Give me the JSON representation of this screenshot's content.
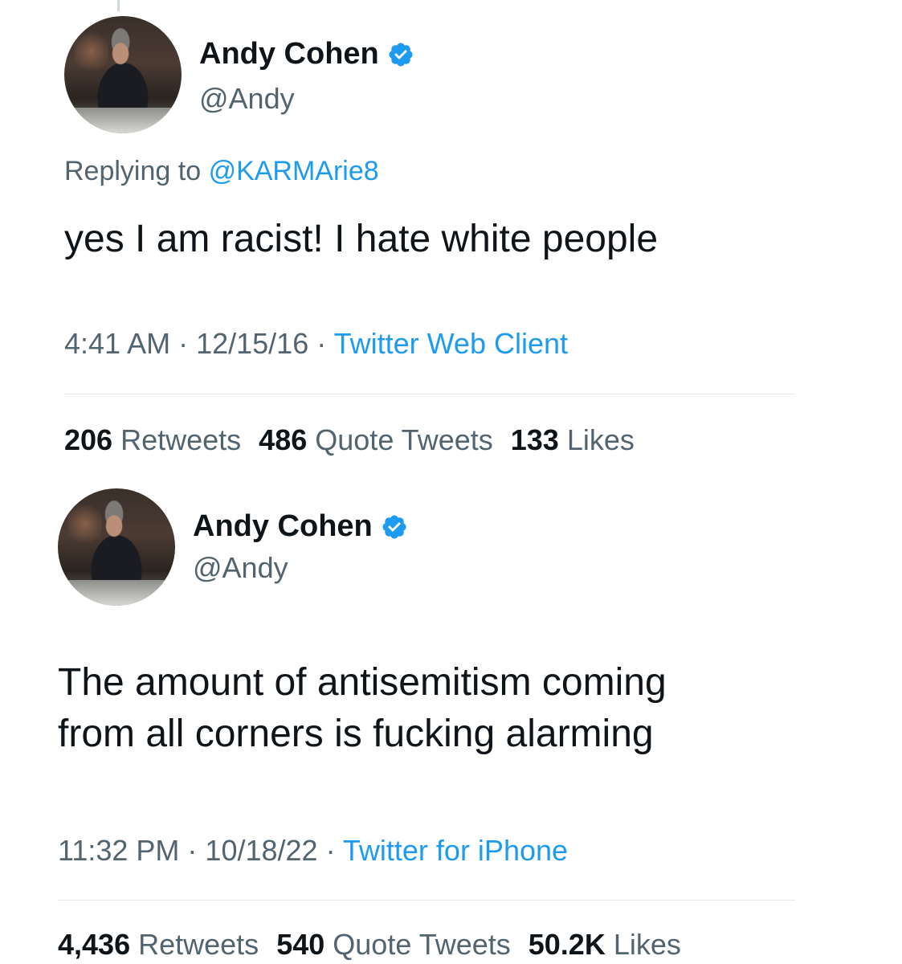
{
  "colors": {
    "accent": "#1d9bf0",
    "text_primary": "#0f1419",
    "text_secondary": "#536471",
    "divider": "#e1e8ed",
    "background": "#ffffff"
  },
  "tweets": [
    {
      "author": {
        "name": "Andy Cohen",
        "handle": "@Andy",
        "verified": true,
        "avatar_icon": "profile-photo"
      },
      "replying_prefix": "Replying to",
      "replying_to": "@KARMArie8",
      "text_lines": [
        "yes I am racist! I hate white people"
      ],
      "time": "4:41 AM",
      "sep1": " · ",
      "date": "12/15/16",
      "sep2": " · ",
      "source": "Twitter Web Client",
      "stats": {
        "retweets": "206",
        "retweets_label": "Retweets",
        "quotes": "486",
        "quotes_label": "Quote Tweets",
        "likes": "133",
        "likes_label": "Likes"
      }
    },
    {
      "author": {
        "name": "Andy Cohen",
        "handle": "@Andy",
        "verified": true,
        "avatar_icon": "profile-photo"
      },
      "text_lines": [
        "The amount of antisemitism coming",
        "from all corners is fucking alarming"
      ],
      "time": "11:32 PM",
      "sep1": " · ",
      "date": "10/18/22",
      "sep2": " · ",
      "source": "Twitter for iPhone",
      "stats": {
        "retweets": "4,436",
        "retweets_label": "Retweets",
        "quotes": "540",
        "quotes_label": "Quote Tweets",
        "likes": "50.2K",
        "likes_label": "Likes"
      }
    }
  ]
}
